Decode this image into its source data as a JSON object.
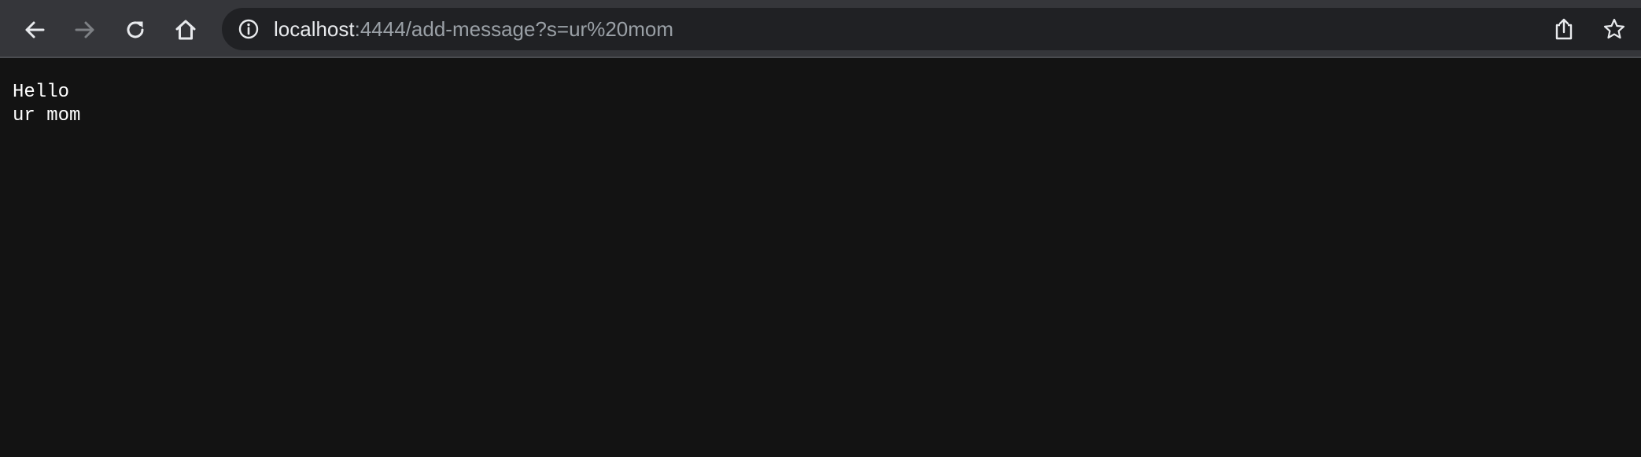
{
  "browser": {
    "url_host": "localhost",
    "url_rest": ":4444/add-message?s=ur%20mom",
    "icons": {
      "back": "back-arrow-icon",
      "forward": "forward-arrow-icon",
      "reload": "reload-icon",
      "home": "home-icon",
      "site_info": "info-icon",
      "share": "share-icon",
      "bookmark": "star-icon"
    },
    "colors": {
      "toolbar": "#35363a",
      "omnibox": "#202124",
      "page_background": "#131313"
    }
  },
  "page": {
    "messages": [
      "Hello",
      "ur mom"
    ]
  }
}
